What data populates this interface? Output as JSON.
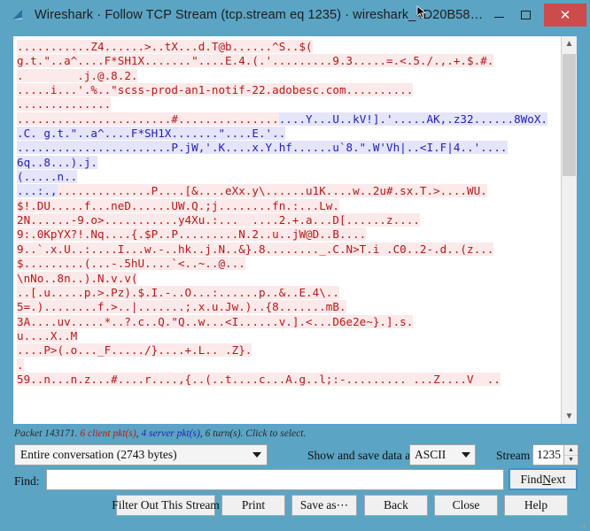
{
  "window": {
    "title": "Wireshark · Follow TCP Stream (tcp.stream eq 1235) · wireshark_4D20B58…",
    "app_icon": "wireshark-fin-icon",
    "minimize_label": "",
    "maximize_label": "",
    "close_label": "✕",
    "titlebar_color": "#5ba4c4",
    "close_button_color": "#cc4b4b"
  },
  "colors": {
    "client_text": "#b31a1a",
    "client_bg": "#fce9e9",
    "server_text": "#2222b5",
    "server_bg": "#e4e4fb",
    "frame_border": "#5a9fd4"
  },
  "stream": {
    "lines": [
      [
        {
          "t": "c",
          "v": "...........Z4......>..tX...d.T@b......^S..$("
        }
      ],
      [
        {
          "t": "c",
          "v": "g.t.\"..a^....F*SH1X.......\"....E.4.(.'.........9.3.....=.<.5./.,.+.$.#."
        }
      ],
      [
        {
          "t": "c",
          "v": ".        .j.@.8.2."
        }
      ],
      [
        {
          "t": "c",
          "v": ".....i...'.%..\"scss-prod-an1-notif-22.adobesc.com.........."
        }
      ],
      [
        {
          "t": "c",
          "v": ".............."
        }
      ],
      [
        {
          "t": "c",
          "v": ".......................#..............."
        },
        {
          "t": "s",
          "v": "....Y...U..kV!].'.....AK,.z32......8WoX."
        }
      ],
      [
        {
          "t": "s",
          "v": ".C. g.t.\"..a^....F*SH1X.......\"....E.'.."
        }
      ],
      [
        {
          "t": "s",
          "v": ".......................P.jW,'.K....x.Y.hf......u`8.\".W'Vh|..<I.F|4..'...."
        }
      ],
      [
        {
          "t": "s",
          "v": "6q..8...).j."
        }
      ],
      [
        {
          "t": "s",
          "v": "(.....n.."
        }
      ],
      [
        {
          "t": "s",
          "v": "...:.,"
        },
        {
          "t": "c",
          "v": "..............P....[&....eXx.y\\......u1K....w..2u#.sx.T.>....WU."
        }
      ],
      [
        {
          "t": "c",
          "v": "$!.DU.....f...neD......UW.Q.;j........fn.:...Lw."
        }
      ],
      [
        {
          "t": "c",
          "v": "2N......-9.o>...........y4Xu.:...  ....2.+.a...D[......z...."
        }
      ],
      [
        {
          "t": "c",
          "v": "9:.0KpYX?!.Nq....{.$P..P.........N.2..u..jW@D..B...."
        }
      ],
      [
        {
          "t": "c",
          "v": "9..`.x.U..:....I...w.-..hk..j.N..&}.8........_.C.N>T.i .C0..2-.d..(z..."
        }
      ],
      [
        {
          "t": "c",
          "v": "$.........(...-.5hU....`<..~..@..."
        }
      ],
      [
        {
          "t": "c",
          "v": "\\nNo..8n..).N.v.v("
        }
      ],
      [
        {
          "t": "c",
          "v": "..[.u.....p.>.Pz).$.I.-..O...:......p..&..E.4\\.."
        }
      ],
      [
        {
          "t": "c",
          "v": "5=.)........f.>..|.......;.x.u.Jw.)..{8.......mB."
        }
      ],
      [
        {
          "t": "c",
          "v": "3A....uv.....*..?.c..Q.\"Q..w...<I......v.].<...D6e2e~}.].s."
        }
      ],
      [
        {
          "t": "c",
          "v": "u....X..M"
        }
      ],
      [
        {
          "t": "c",
          "v": "....P>(.o..._F...../}....+.L.. .Z}."
        }
      ],
      [
        {
          "t": "c",
          "v": "."
        }
      ],
      [
        {
          "t": "c",
          "v": "59..n...n.z...#....r....,{..(..t....c...A.g..l;:-......... ...Z....V  .."
        }
      ]
    ],
    "scrollbar": {
      "up_arrow": "▲",
      "down_arrow": "▼",
      "name": "vertical-scrollbar"
    }
  },
  "status": {
    "prefix": "Packet 143171. ",
    "client_part": "6 client pkt(s)",
    "mid": ", ",
    "server_part": "4 server pkt(s)",
    "suffix": ", 6 turn(s). Click to select."
  },
  "controls": {
    "conversation_value": "Entire conversation (2743 bytes)",
    "show_save_label": "Show and save data as",
    "format_value": "ASCII",
    "stream_label": "Stream",
    "stream_value": "1235",
    "spin_up": "▲",
    "spin_down": "▼",
    "find_label": "Find:",
    "find_value": "",
    "find_placeholder": "",
    "find_next_pre": "Find ",
    "find_next_accel": "N",
    "find_next_post": "ext"
  },
  "buttons": {
    "filter_out": "Filter Out This Stream",
    "print": "Print",
    "save_as": "Save as⋯",
    "back": "Back",
    "close": "Close",
    "help": "Help"
  }
}
